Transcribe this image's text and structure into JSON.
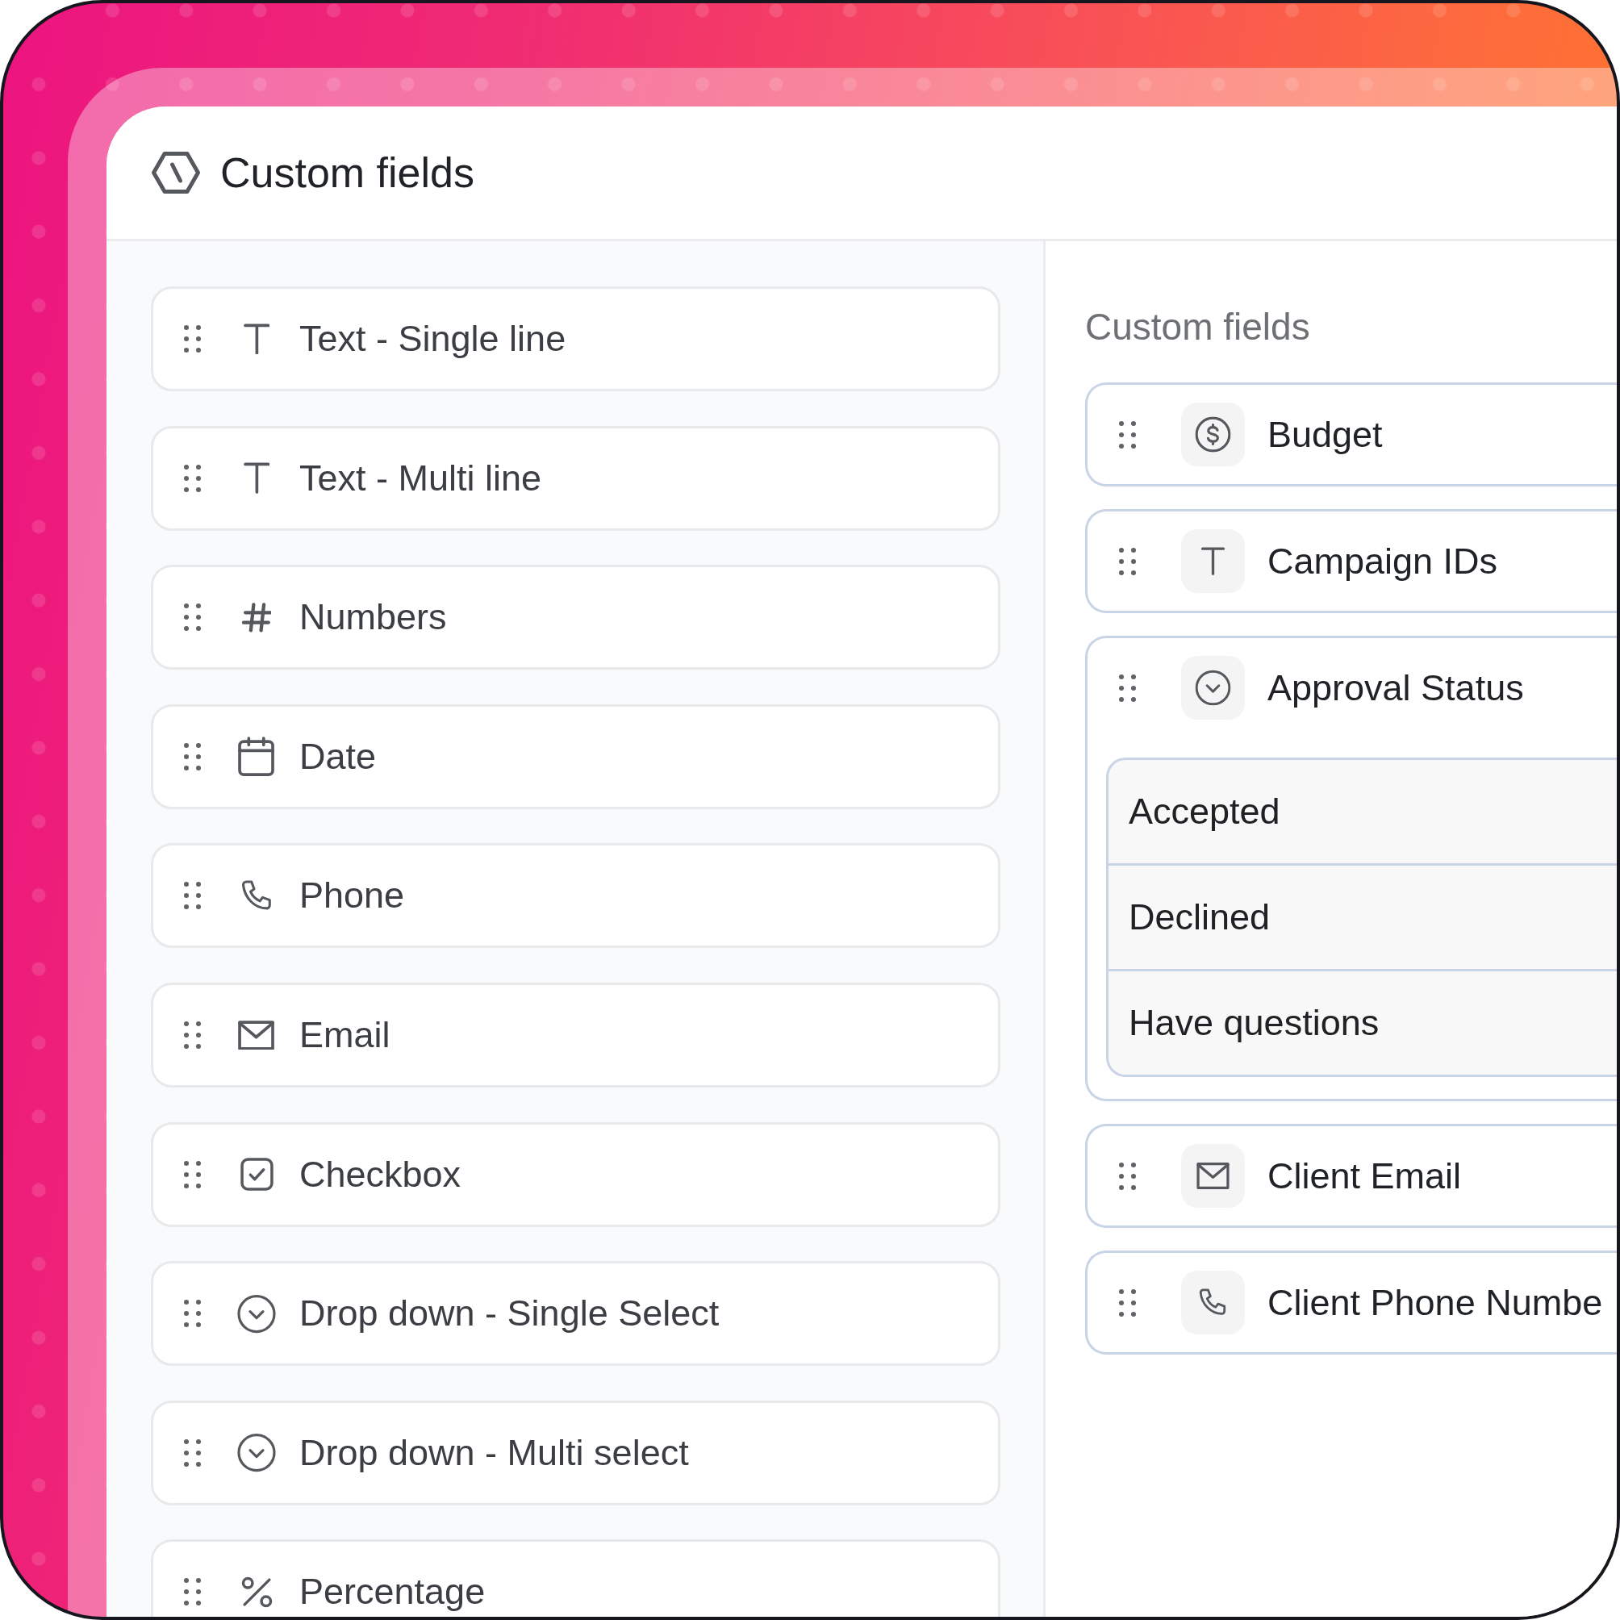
{
  "header": {
    "title": "Custom fields"
  },
  "field_types": [
    {
      "label": "Text - Single line",
      "kind": "text"
    },
    {
      "label": "Text - Multi line",
      "kind": "text"
    },
    {
      "label": "Numbers",
      "kind": "number"
    },
    {
      "label": "Date",
      "kind": "date"
    },
    {
      "label": "Phone",
      "kind": "phone"
    },
    {
      "label": "Email",
      "kind": "email"
    },
    {
      "label": "Checkbox",
      "kind": "checkbox"
    },
    {
      "label": "Drop down - Single Select",
      "kind": "dropdown"
    },
    {
      "label": "Drop down - Multi select",
      "kind": "dropdown"
    },
    {
      "label": "Percentage",
      "kind": "percentage"
    }
  ],
  "custom_fields": {
    "title": "Custom fields",
    "fields": [
      {
        "label": "Budget",
        "kind": "currency"
      },
      {
        "label": "Campaign IDs",
        "kind": "text"
      },
      {
        "label": "Approval Status",
        "kind": "dropdown",
        "options": [
          "Accepted",
          "Declined",
          "Have questions"
        ]
      },
      {
        "label": "Client Email",
        "kind": "email"
      },
      {
        "label": "Client Phone Numbe",
        "kind": "phone"
      }
    ]
  }
}
